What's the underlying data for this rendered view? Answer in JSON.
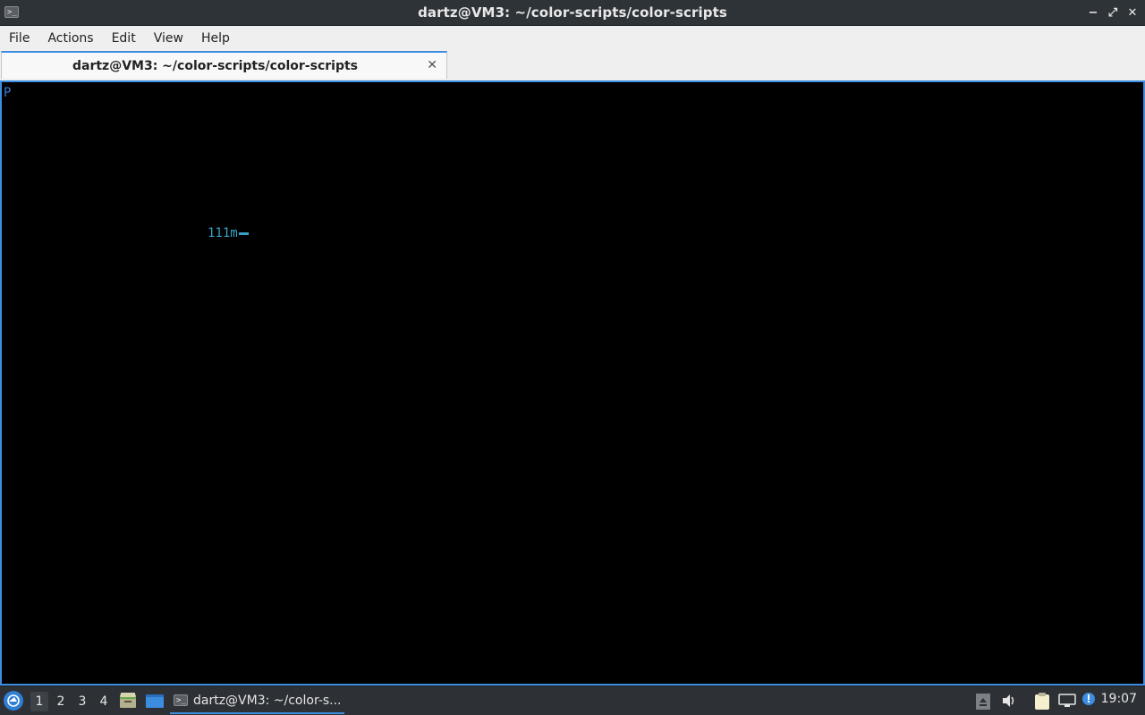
{
  "window": {
    "title": "dartz@VM3: ~/color-scripts/color-scripts",
    "app_icon_glyph": ">_",
    "controls": {
      "minimize": "−",
      "maximize": "⤢",
      "close": "✕"
    }
  },
  "menubar": {
    "items": [
      {
        "label": "File"
      },
      {
        "label": "Actions"
      },
      {
        "label": "Edit"
      },
      {
        "label": "View"
      },
      {
        "label": "Help"
      }
    ]
  },
  "tabs": [
    {
      "label": "dartz@VM3: ~/color-scripts/color-scripts",
      "close": "✕",
      "active": true
    }
  ],
  "terminal": {
    "lines": [
      {
        "text": "P",
        "color": "#3d7bd9"
      },
      {
        "text": "111m",
        "color": "#3aa0c8"
      }
    ]
  },
  "taskbar": {
    "workspaces": [
      "1",
      "2",
      "3",
      "4"
    ],
    "active_workspace": "1",
    "quicklaunch": [
      "file-manager-icon",
      "desktop-icon"
    ],
    "task": {
      "label": "dartz@VM3: ~/color-s...",
      "icon_glyph": ">_"
    },
    "tray": [
      "eject-icon",
      "volume-icon",
      "clipboard-icon",
      "network-icon",
      "update-notifier-icon"
    ],
    "clock": "19:07"
  },
  "colors": {
    "accent": "#3d8ee0",
    "terminal_bg": "#000000",
    "panel_bg": "#2d3135"
  }
}
